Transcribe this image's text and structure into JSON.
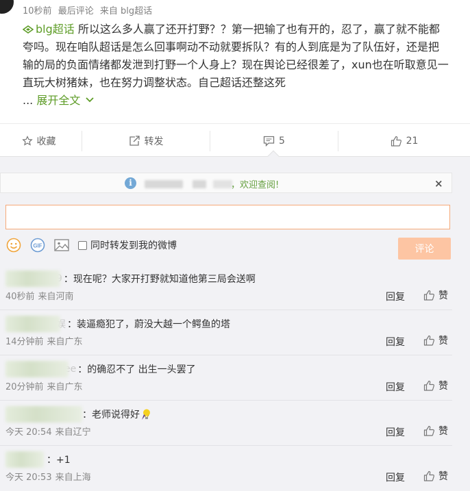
{
  "post": {
    "time": "10秒前",
    "latest_label": "最后评论",
    "source": "来自 blg超话",
    "topic": "blg超话",
    "body": "所以这么多人赢了还开打野？？第一把输了也有开的，忍了，赢了就不能都夸吗。现在咱队超话是怎么回事啊动不动就要拆队？有的人到底是为了队伍好，还是把输的局的负面情绪都发泄到打野一个人身上？现在舆论已经很差了，xun也在听取意见一直玩大树猪妹，也在努力调整状态。自己超话还整这死",
    "ellipsis": "...",
    "expand": "展开全文"
  },
  "actions": {
    "favorite": "收藏",
    "forward": "转发",
    "comment_count": "5",
    "like_count": "21"
  },
  "notice": {
    "text": "，欢迎查阅!",
    "close": "×"
  },
  "composer": {
    "input_value": "",
    "sync_label": "同时转发到我的微博",
    "submit": "评论"
  },
  "comments": [
    {
      "name_tail": "9",
      "text": "：现在呢？大家开打野就知道他第三局会送啊",
      "time": "40秒前",
      "from": "来自河南",
      "reply": "回复",
      "like": "赞"
    },
    {
      "name_tail": "娱",
      "text": "：装逼瘾犯了，蔚没大越一个鳄鱼的塔",
      "time": "14分钟前",
      "from": "来自广东",
      "reply": "回复",
      "like": "赞"
    },
    {
      "name_tail": "ee",
      "text": "：的确忍不了 出生一头罢了",
      "time": "20分钟前",
      "from": "来自广东",
      "reply": "回复",
      "like": "赞"
    },
    {
      "name_tail": "",
      "text": "：老师说得好",
      "time": "今天 20:54",
      "from": "来自辽宁",
      "reply": "回复",
      "like": "赞"
    },
    {
      "name_tail": "",
      "text": "：+1",
      "time": "今天 20:53",
      "from": "来自上海",
      "reply": "回复",
      "like": "赞"
    }
  ],
  "colors": {
    "accent_green": "#5d9c26",
    "submit_disabled": "#fdc5a3",
    "input_border": "#f6a978",
    "panel_bg": "#f2f2f5"
  }
}
